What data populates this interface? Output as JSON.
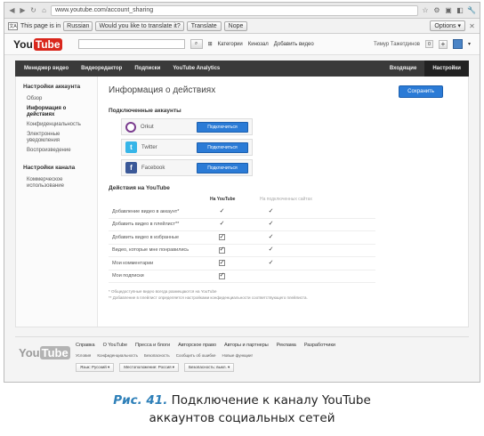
{
  "browser": {
    "url": "www.youtube.com/account_sharing",
    "translate_bar": {
      "text_before": "This page is in",
      "language": "Russian",
      "question": "Would you like to translate it?",
      "translate_label": "Translate",
      "nope_label": "Nope",
      "options_label": "Options"
    }
  },
  "header": {
    "logo_you": "You",
    "logo_tube": "Tube",
    "links": [
      "Категории",
      "Кинозал",
      "Добавить видео"
    ],
    "user": "Тимур Тажетдинов",
    "notif_count": "0",
    "plus": "+"
  },
  "topnav": {
    "left": [
      "Менеджер видео",
      "Видеоредактор",
      "Подписки",
      "YouTube Analytics"
    ],
    "inbox": "Входящие",
    "settings": "Настройки"
  },
  "sidebar": {
    "account_head": "Настройки аккаунта",
    "account_items": [
      "Обзор",
      "Информация о действиях",
      "Конфиденциальность",
      "Электронные уведомления",
      "Воспроизведение"
    ],
    "channel_head": "Настройки канала",
    "channel_items": [
      "Коммерческое использование"
    ]
  },
  "main": {
    "title": "Информация о действиях",
    "save_label": "Сохранить",
    "connected_head": "Подключенные аккаунты",
    "socials": [
      {
        "name": "Orkut",
        "button": "Подключиться"
      },
      {
        "name": "Twitter",
        "button": "Подключиться"
      },
      {
        "name": "Facebook",
        "button": "Подключиться"
      }
    ],
    "actions_head": "Действия на YouTube",
    "col_youtube": "На YouTube",
    "col_social": "На подключенных сайтах",
    "actions": [
      {
        "label": "Добавление видео в аккаунт*",
        "yt": "check",
        "social": "check"
      },
      {
        "label": "Добавить видео в плейлист**",
        "yt": "check",
        "social": "check"
      },
      {
        "label": "Добавить видео в избранные",
        "yt": "box",
        "social": "check"
      },
      {
        "label": "Видео, которые мне понравились",
        "yt": "box",
        "social": "check"
      },
      {
        "label": "Мои комментарии",
        "yt": "box",
        "social": "check"
      },
      {
        "label": "Мои подписки",
        "yt": "box",
        "social": ""
      }
    ],
    "note1": "* Общедоступные видео всегда размещаются на YouTube",
    "note2": "** Добавление в плейлист определяется настройками конфиденциальности соответствующего плейлиста."
  },
  "footer": {
    "logo_you": "You",
    "logo_tube": "Tube",
    "links": [
      "Справка",
      "О YouTube",
      "Пресса и блоги",
      "Авторское право",
      "Авторы и партнеры",
      "Реклама",
      "Разработчики"
    ],
    "small_links": [
      "Условия",
      "Конфиденциальность",
      "Безопасность",
      "Сообщить об ошибке",
      "Новые функции!"
    ],
    "language": "Язык: Русский ▾",
    "location": "Местоположение: Россия ▾",
    "safety": "Безопасность: выкл. ▾"
  },
  "caption": {
    "label": "Рис. 41.",
    "text1": "Подключение к каналу YouTube",
    "text2": "аккаунтов социальных сетей"
  }
}
